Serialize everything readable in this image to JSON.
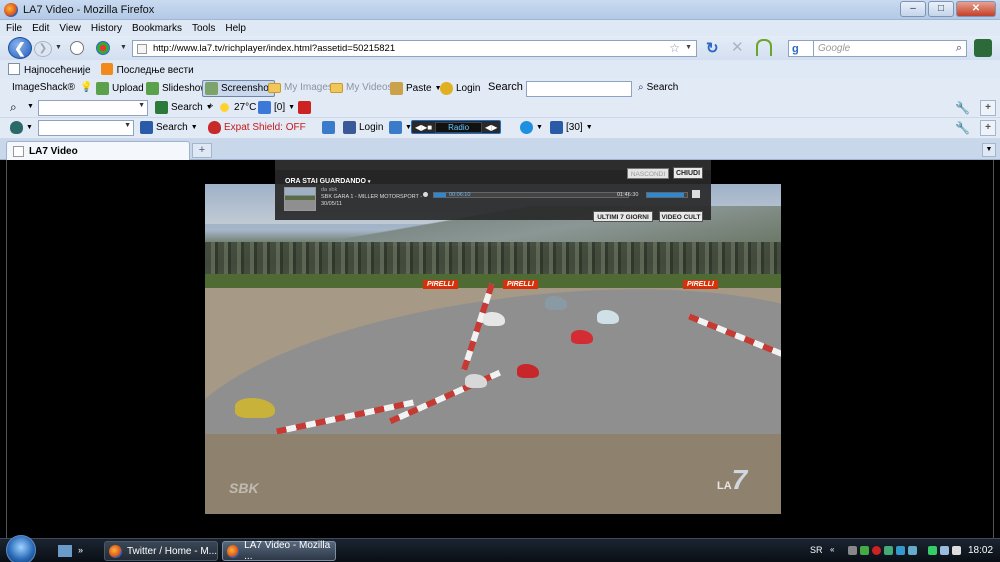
{
  "window": {
    "title": "LA7 Video - Mozilla Firefox",
    "minimize": "–",
    "maximize": "□",
    "close": "✕"
  },
  "menu": [
    "File",
    "Edit",
    "View",
    "History",
    "Bookmarks",
    "Tools",
    "Help"
  ],
  "nav": {
    "url": "http://www.la7.tv/richplayer/index.html?assetid=50215821",
    "search_placeholder": "Google",
    "back": "❮",
    "forward": "❯"
  },
  "bookmarks": [
    "Најпосећеније",
    "Последње вести"
  ],
  "toolbar1": {
    "brand": "ImageShack®",
    "upload": "Upload",
    "slideshow": "Slideshow",
    "screenshot": "Screenshot",
    "my_images": "My Images",
    "my_videos": "My Videos",
    "paste": "Paste",
    "login": "Login",
    "search_label": "Search",
    "search_button": "Search"
  },
  "toolbar2": {
    "search": "Search",
    "temperature": "27°C",
    "mail_count": "[0]"
  },
  "toolbar3": {
    "search": "Search",
    "expat": "Expat Shield: OFF",
    "login": "Login",
    "radio": "Radio",
    "count": "[30]"
  },
  "tab": {
    "title": "LA7 Video",
    "new_tab": "+"
  },
  "player": {
    "nascondi": "NASCONDI",
    "chiudi": "CHIUDI",
    "now_watching": "ORA STAI GUARDANDO",
    "source": "da sbk",
    "clip_title": "SBK GARA 1 - MILLER MOTORSPORT - 30/05/11",
    "time_current": "00:06:10",
    "time_total": "01:46:30",
    "progress": 0.06,
    "volume": 0.92,
    "btn_last7": "ULTIMI 7 GIORNI",
    "btn_cult": "VIDEO CULT"
  },
  "video": {
    "banner": "PIRELLI",
    "logo_sbk": "SBK",
    "logo_la7": "LA",
    "logo_7": "7"
  },
  "taskbar": {
    "tasks": [
      "Twitter / Home - M...",
      "LA7 Video - Mozilla ..."
    ],
    "lang": "SR",
    "clock": "18:02"
  }
}
